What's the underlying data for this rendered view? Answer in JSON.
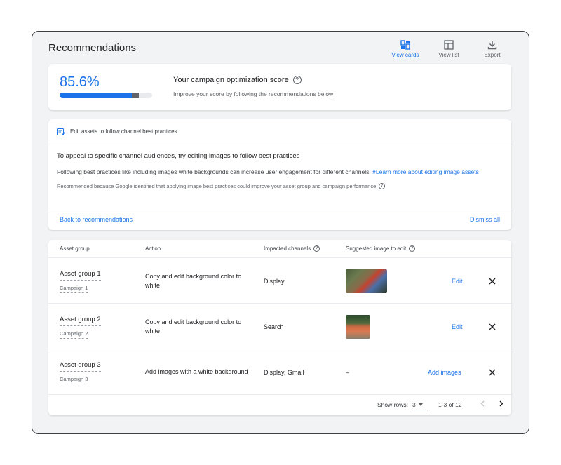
{
  "page": {
    "title": "Recommendations"
  },
  "toolbar": {
    "view_cards": {
      "label": "View cards",
      "icon": "view-cards-icon"
    },
    "view_list": {
      "label": "View list",
      "icon": "view-list-icon"
    },
    "export": {
      "label": "Export",
      "icon": "download-icon"
    }
  },
  "score": {
    "value": "85.6%",
    "progress": 0.856,
    "title": "Your campaign optimization score",
    "subtitle": "Improve your score by following the recommendations below"
  },
  "recommendation": {
    "header": "Edit assets to follow channel best practices",
    "title": "To appeal to specific channel audiences, try editing images to follow best practices",
    "description": "Following best practices like including images white backgrounds can increase user engagement for different channels.",
    "learn_more": "#Learn more about editing image assets",
    "note": "Recommended because Google identified that applying image best practices could improve your asset group and campaign performance",
    "back_label": "Back to recommendations",
    "dismiss_label": "Dismiss all"
  },
  "table": {
    "headers": {
      "asset_group": "Asset group",
      "action": "Action",
      "impacted_channels": "Impacted channels",
      "suggested_image": "Suggested image to edit"
    },
    "rows": [
      {
        "asset_group": "Asset group 1",
        "campaign": "Campaign 1",
        "action": "Copy and edit background color to white",
        "channels": "Display",
        "image": "thumb1",
        "link": "Edit"
      },
      {
        "asset_group": "Asset group 2",
        "campaign": "Campaign 2",
        "action": "Copy and edit background color to white",
        "channels": "Search",
        "image": "thumb2",
        "link": "Edit"
      },
      {
        "asset_group": "Asset group 3",
        "campaign": "Campaign 3",
        "action": "Add images with a white background",
        "channels": "Display, Gmail",
        "image": "–",
        "link": "Add images"
      }
    ],
    "footer": {
      "rows_label": "Show rows:",
      "rows_value": "3",
      "range": "1-3 of 12"
    }
  },
  "colors": {
    "accent": "#1a73e8",
    "background": "#f1f3f4",
    "text": "#202124",
    "muted": "#5f6368"
  }
}
